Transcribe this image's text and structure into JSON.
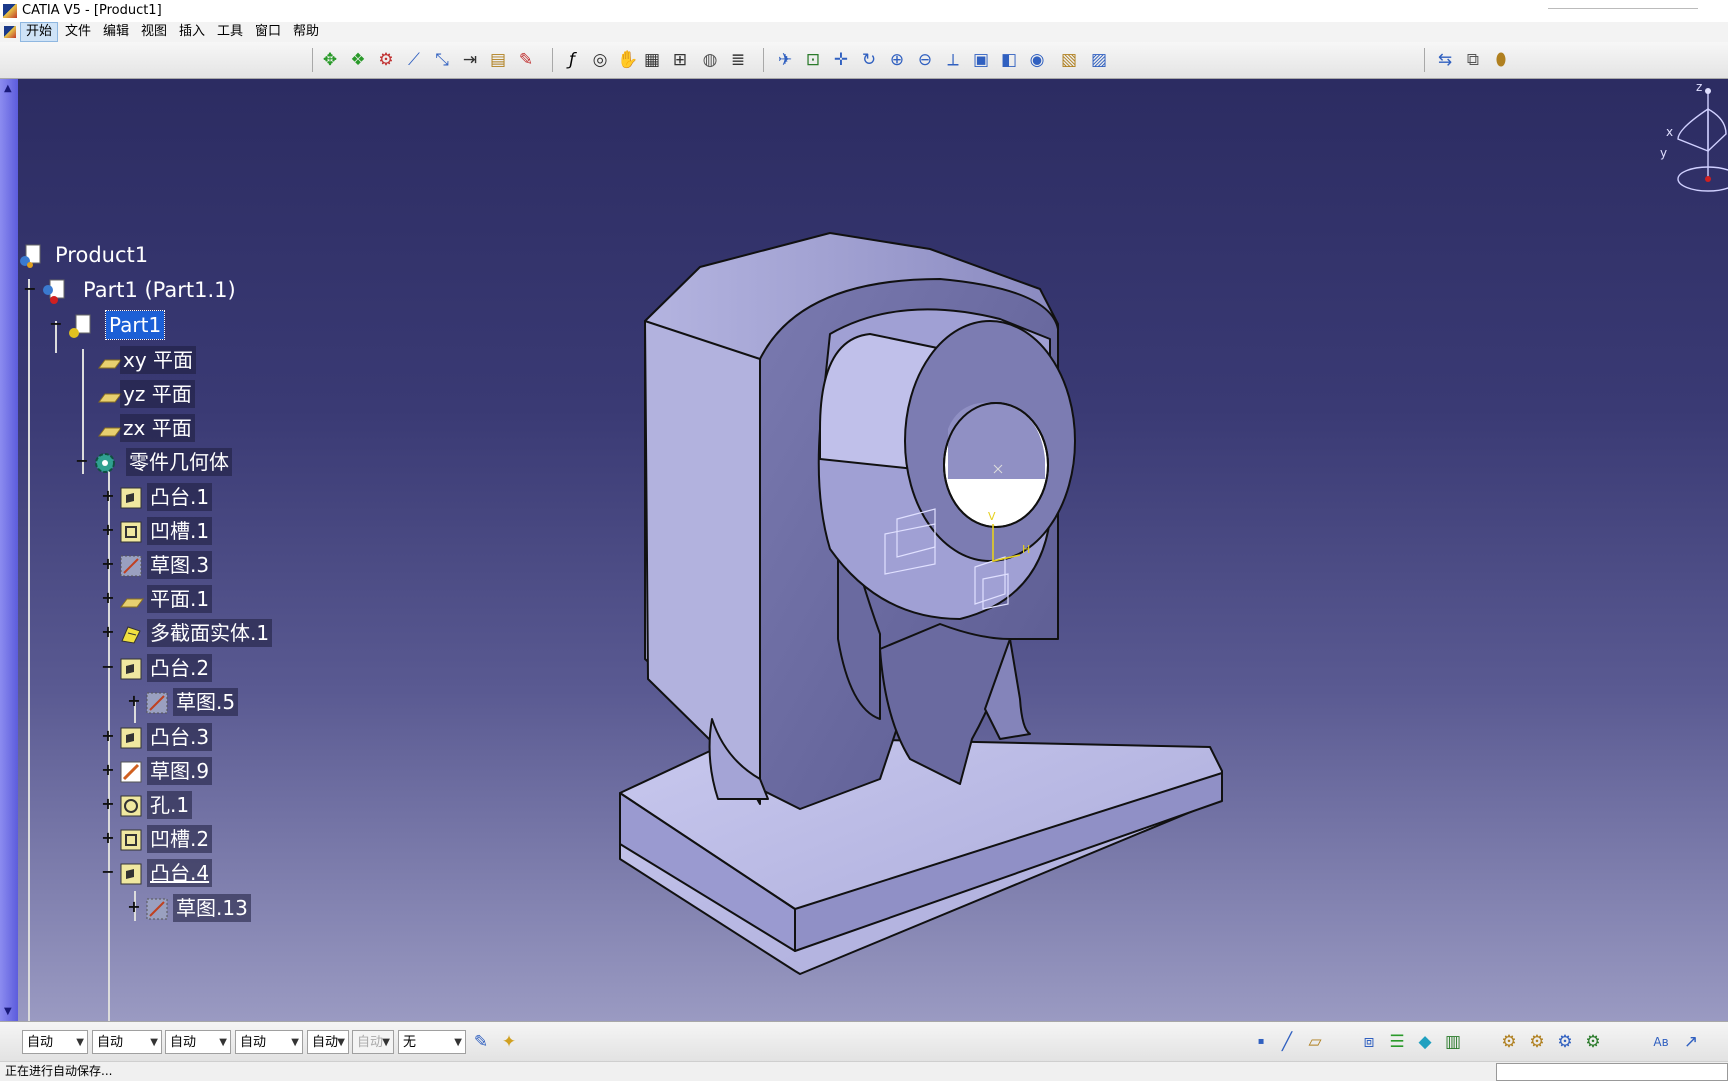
{
  "window": {
    "title": "CATIA V5 - [Product1]"
  },
  "menu": [
    "开始",
    "文件",
    "编辑",
    "视图",
    "插入",
    "工具",
    "窗口",
    "帮助"
  ],
  "top_toolbar": {
    "icons": [
      "move-compass-icon",
      "snap-icon",
      "manipulate-icon",
      "measure-icon",
      "measure-between-icon",
      "distance-icon",
      "inertia-icon",
      "clash-icon",
      "formula-icon",
      "comment-icon",
      "hand-icon",
      "table-icon",
      "knowledge-icon",
      "lock-icon",
      "parameter-icon",
      "fly-icon",
      "fit-all-icon",
      "pan-icon",
      "rotate-icon",
      "zoom-in-icon",
      "zoom-out-icon",
      "normal-view-icon",
      "multi-view-icon",
      "iso-view-icon",
      "shading-icon",
      "hide-show-icon",
      "swap-icon"
    ],
    "right_icons": [
      "assembly-constraint-icon",
      "product-tool-icon",
      "catalog-icon"
    ]
  },
  "tree": {
    "root": "Product1",
    "part_instance": "Part1 (Part1.1)",
    "part": "Part1",
    "planes": [
      "xy 平面",
      "yz 平面",
      "zx 平面"
    ],
    "body": "零件几何体",
    "features": [
      {
        "label": "凸台.1",
        "type": "pad",
        "toggle": "+"
      },
      {
        "label": "凹槽.1",
        "type": "pocket",
        "toggle": "+"
      },
      {
        "label": "草图.3",
        "type": "sketch",
        "toggle": "+"
      },
      {
        "label": "平面.1",
        "type": "plane",
        "toggle": "+"
      },
      {
        "label": "多截面实体.1",
        "type": "multisection",
        "toggle": "+"
      },
      {
        "label": "凸台.2",
        "type": "pad",
        "toggle": "-"
      },
      {
        "label": "草图.5",
        "type": "sketch",
        "toggle": "+",
        "child": true
      },
      {
        "label": "凸台.3",
        "type": "pad",
        "toggle": "+"
      },
      {
        "label": "草图.9",
        "type": "sketch",
        "toggle": "+"
      },
      {
        "label": "孔.1",
        "type": "hole",
        "toggle": "+"
      },
      {
        "label": "凹槽.2",
        "type": "pocket",
        "toggle": "+"
      },
      {
        "label": "凸台.4",
        "type": "pad",
        "toggle": "-"
      },
      {
        "label": "草图.13",
        "type": "sketch",
        "toggle": "+",
        "child": true
      }
    ]
  },
  "compass": {
    "z": "z",
    "x": "x",
    "y": "y"
  },
  "sketch_axes": {
    "v": "V",
    "h": "H"
  },
  "bottom_toolbar": {
    "combos": [
      "自动",
      "自动",
      "自动",
      "自动",
      "自动",
      "自动",
      "无"
    ],
    "icons": [
      "painter-icon",
      "graphic-properties-icon",
      "point-icon",
      "line-icon",
      "plane-icon",
      "part-design-icon",
      "layer-icon",
      "eraser-icon",
      "book-icon",
      "assembly-icon",
      "assembly2-icon",
      "assembly3-icon",
      "assembly4-icon",
      "spell-icon",
      "arrow-icon"
    ]
  },
  "status": {
    "message": "正在进行自动保存..."
  },
  "colors": {
    "viewport_top": "#2c2c62",
    "viewport_bottom": "#9a9ac2",
    "selection": "#1c5fd6",
    "part_face": "#b0b0e0"
  }
}
